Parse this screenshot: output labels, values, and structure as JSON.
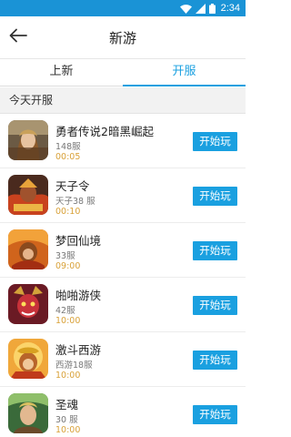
{
  "status_bar": {
    "time": "2:34"
  },
  "app_bar": {
    "title": "新游"
  },
  "tabs": [
    {
      "label": "上新",
      "active": false
    },
    {
      "label": "开服",
      "active": true
    }
  ],
  "section": {
    "title": "今天开服"
  },
  "games": [
    {
      "name": "勇者传说2暗黑崛起",
      "server": "148服",
      "time": "00:05",
      "button": "开始玩",
      "icon": "warrior-princess-icon"
    },
    {
      "name": "天子令",
      "server": "天子38 服",
      "time": "00:10",
      "button": "开始玩",
      "icon": "fire-warrior-icon"
    },
    {
      "name": "梦回仙境",
      "server": "33服",
      "time": "09:00",
      "button": "开始玩",
      "icon": "fire-monkey-icon"
    },
    {
      "name": "啪啪游侠",
      "server": "42服",
      "time": "10:00",
      "button": "开始玩",
      "icon": "red-demon-icon"
    },
    {
      "name": "激斗西游",
      "server": "西游18服",
      "time": "10:00",
      "button": "开始玩",
      "icon": "monkey-king-icon"
    },
    {
      "name": "圣魂",
      "server": "30 服",
      "time": "10:00",
      "button": "开始玩",
      "icon": "elf-warrior-icon"
    }
  ],
  "colors": {
    "accent": "#1aa0e0",
    "status_bar": "#1a93d6",
    "time_text": "#d9a23a"
  }
}
